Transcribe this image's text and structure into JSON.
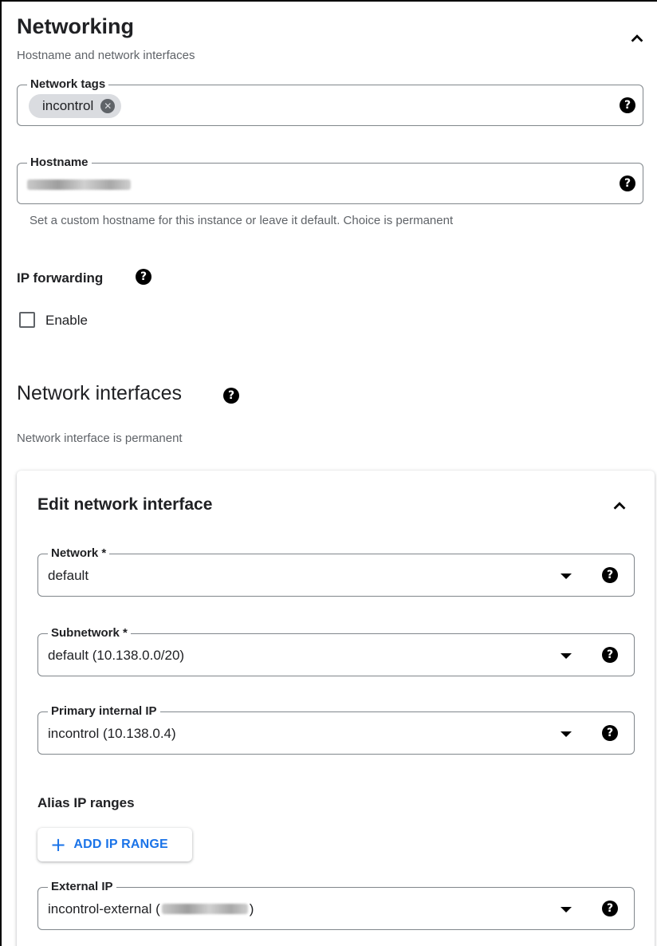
{
  "networking": {
    "title": "Networking",
    "subtitle": "Hostname and network interfaces"
  },
  "network_tags": {
    "label": "Network tags",
    "chips": [
      "incontrol"
    ],
    "remove_glyph": "✕"
  },
  "hostname": {
    "label": "Hostname",
    "value_redacted": true,
    "hint": "Set a custom hostname for this instance or leave it default. Choice is permanent"
  },
  "ip_forwarding": {
    "label": "IP forwarding",
    "checkbox_label": "Enable",
    "checked": false
  },
  "network_interfaces": {
    "title": "Network interfaces",
    "subtitle": "Network interface is permanent"
  },
  "edit_interface": {
    "title": "Edit network interface",
    "network": {
      "label": "Network *",
      "value": "default"
    },
    "subnetwork": {
      "label": "Subnetwork *",
      "value": "default (10.138.0.0/20)"
    },
    "primary_internal_ip": {
      "label": "Primary internal IP",
      "value": "incontrol (10.138.0.4)"
    },
    "alias_ip_ranges": {
      "label": "Alias IP ranges",
      "add_button": "ADD IP RANGE",
      "add_glyph": "+"
    },
    "external_ip": {
      "label": "External IP",
      "value_prefix": "incontrol-external (",
      "value_suffix": ")",
      "ip_redacted": true
    }
  },
  "icons": {
    "help": "?",
    "collapse": "chevron-up-icon",
    "dropdown": "arrow-drop-down-icon"
  },
  "colors": {
    "accent": "#1a73e8",
    "text": "#202124",
    "muted": "#5f6368",
    "outline": "#80868b",
    "chip": "#dadce0"
  }
}
